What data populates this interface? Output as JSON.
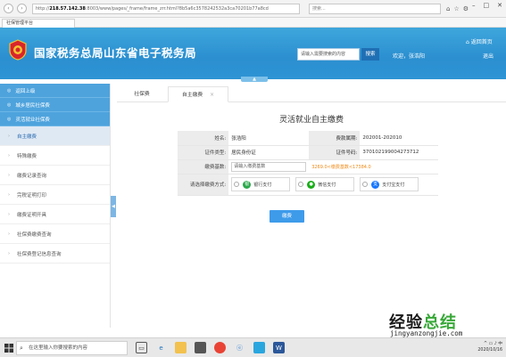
{
  "browser": {
    "address_prefix": "http://",
    "address_ip": "218.57.142.38",
    "address_rest": ":8003/www/pages/_frame/frame_zrr.html?8b5a6c3578242532a3ca70201b77a8cd",
    "search_placeholder": "搜索...",
    "tab_label": "社保管理平台"
  },
  "header": {
    "title": "国家税务总局山东省电子税务局",
    "search_placeholder": "请输入需要搜索的内容",
    "search_button": "搜索",
    "welcome": "欢迎，张浩阳",
    "home_link": "返回首页",
    "logout": "退出"
  },
  "sidebar": {
    "sections": [
      {
        "label": "返回上级"
      },
      {
        "label": "城乡居民社保费"
      },
      {
        "label": "灵活就业社保费"
      }
    ],
    "items": [
      {
        "label": "自主缴费"
      },
      {
        "label": "特殊缴费"
      },
      {
        "label": "缴费记录查询"
      },
      {
        "label": "完税证明打印"
      },
      {
        "label": "缴费证明开具"
      },
      {
        "label": "社保费缴费查询"
      },
      {
        "label": "社保费登记信息查询"
      }
    ]
  },
  "tabs": [
    {
      "label": "社保费"
    },
    {
      "label": "自主缴费"
    }
  ],
  "form": {
    "title": "灵活就业自主缴费",
    "name_label": "姓名:",
    "name_value": "张浩阳",
    "period_label": "费款属期:",
    "period_value": "202001-202010",
    "id_type_label": "证件类型:",
    "id_type_value": "居民身份证",
    "id_no_label": "证件号码:",
    "id_no_value": "370102199004273712",
    "base_label": "缴费基数:",
    "base_placeholder": "请输入缴费基数",
    "base_hint": "3269.0<缴费基数<17384.0",
    "pay_method_label": "请选择缴费方式:",
    "pay_options": [
      {
        "label": "银行支付",
        "icon": "bank-icon",
        "color": "#2aa84a"
      },
      {
        "label": "微信支付",
        "icon": "wechat-icon",
        "color": "#1aad19"
      },
      {
        "label": "支付宝支付",
        "icon": "alipay-icon",
        "color": "#1677ff"
      }
    ],
    "submit": "缴费"
  },
  "watermark": {
    "line1_black": "经验",
    "line1_green": "总结",
    "line2": "jingyanzongjie.com"
  },
  "taskbar": {
    "search_placeholder": "在这里输入你要搜索的内容",
    "date": "2020/10/16"
  },
  "colors": {
    "header_blue": "#2b8fd0",
    "sidebar_section": "#4ea3dd",
    "button_blue": "#3e9bea",
    "hint_orange": "#f08a16"
  }
}
